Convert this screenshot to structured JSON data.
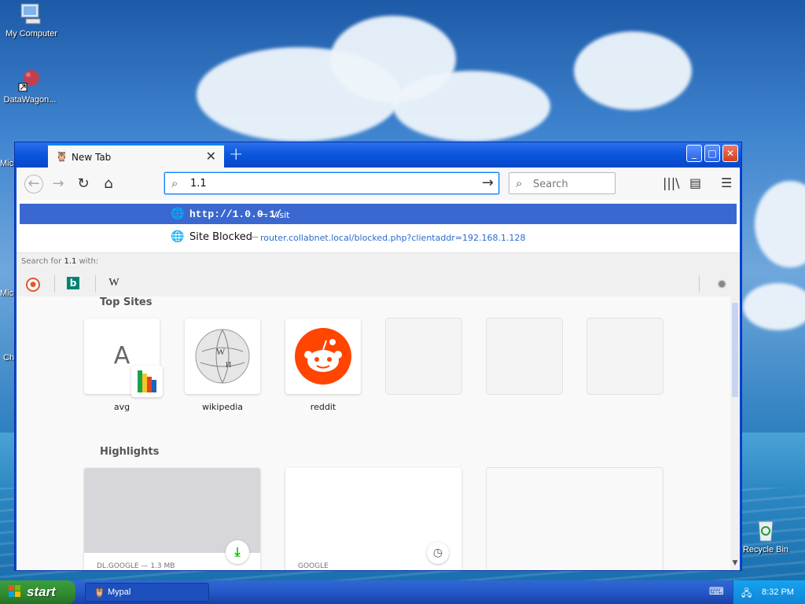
{
  "desktop": {
    "icons": [
      {
        "label": "My Computer"
      },
      {
        "label": "DataWagon..."
      },
      {
        "label": "Recycle Bin"
      }
    ],
    "partial_labels": [
      "Mic",
      "Mic",
      "Ch"
    ]
  },
  "browser": {
    "tab": {
      "title": "New Tab",
      "close": "✕"
    },
    "new_tab_icon": "+",
    "window_buttons": {
      "minimize": "_",
      "maximize": "□",
      "close": "✕"
    },
    "toolbar": {
      "back_icon": "←",
      "forward_icon": "→",
      "reload_icon": "↻",
      "home_icon": "⌂",
      "url_value": "1.1",
      "go_icon": "→",
      "search_placeholder": "Search",
      "library_icon": "|||\\",
      "sidebar_icon": "▤",
      "menu_icon": "☰"
    },
    "dropdown": {
      "suggestions": [
        {
          "title": "http://1.0.0.1/",
          "separator": "—",
          "action": "Visit"
        },
        {
          "title": "Site Blocked",
          "separator": "—",
          "url": "router.collabnet.local/blocked.php?clientaddr=192.168.1.128"
        }
      ],
      "search_for_prefix": "Search for",
      "search_for_query": "1.1",
      "search_for_suffix": "with:",
      "engines": [
        {
          "name": "duckduckgo-icon",
          "glyph": "●"
        },
        {
          "name": "bing-icon",
          "glyph": "b"
        },
        {
          "name": "wikipedia-icon",
          "glyph": "W"
        }
      ],
      "settings_icon": "✹"
    },
    "content": {
      "top_sites_title": "Top Sites",
      "top_sites": [
        {
          "label": "avg",
          "letter": "A"
        },
        {
          "label": "wikipedia"
        },
        {
          "label": "reddit"
        },
        {
          "label": ""
        },
        {
          "label": ""
        },
        {
          "label": ""
        }
      ],
      "highlights_title": "Highlights",
      "highlights": [
        {
          "meta": "DL.GOOGLE — 1.3 MB"
        },
        {
          "meta": "GOOGLE"
        },
        {
          "meta": ""
        }
      ]
    }
  },
  "taskbar": {
    "start_label": "start",
    "task_label": "Mypal",
    "clock": "8:32 PM"
  }
}
